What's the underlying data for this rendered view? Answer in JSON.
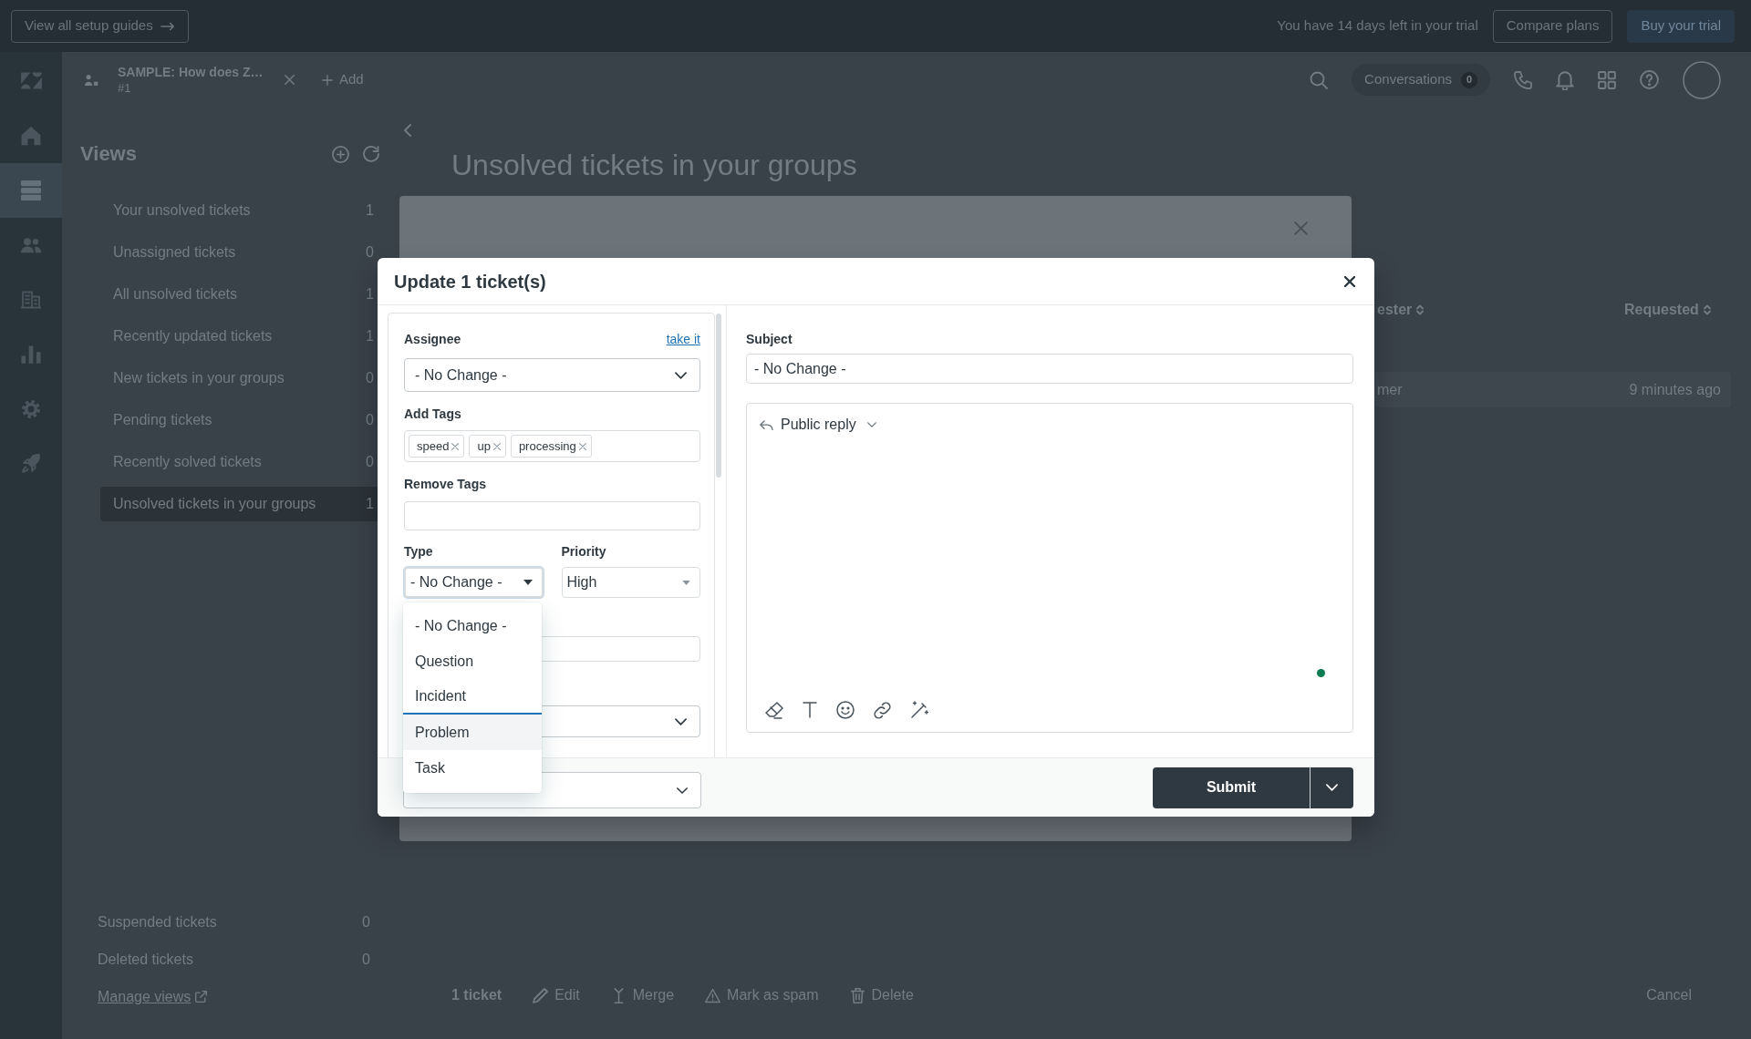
{
  "top_bar": {
    "setup_button": "View all setup guides",
    "trial_notice": "You have 14 days left in your trial",
    "buttons": [
      {
        "label": "Compare plans",
        "kind": "outline"
      },
      {
        "label": "Buy your trial",
        "kind": "filled"
      }
    ]
  },
  "nav_rail": {
    "items": [
      {
        "selected": false
      },
      {
        "selected": true
      },
      {
        "selected": false
      },
      {
        "selected": false
      },
      {
        "selected": false
      },
      {
        "selected": false
      },
      {
        "selected": false
      }
    ]
  },
  "header": {
    "tab": {
      "title": "SAMPLE: How does Z…",
      "subtitle": "#1"
    },
    "add_tab": "Add",
    "conversations": {
      "label": "Conversations",
      "count": "0"
    }
  },
  "views": {
    "title": "Views",
    "items": [
      {
        "label": "Your unsolved tickets",
        "count": "1",
        "selected": false
      },
      {
        "label": "Unassigned tickets",
        "count": "0",
        "selected": false
      },
      {
        "label": "All unsolved tickets",
        "count": "1",
        "selected": false
      },
      {
        "label": "Recently updated tickets",
        "count": "1",
        "selected": false
      },
      {
        "label": "New tickets in your groups",
        "count": "0",
        "selected": false
      },
      {
        "label": "Pending tickets",
        "count": "0",
        "selected": false
      },
      {
        "label": "Recently solved tickets",
        "count": "0",
        "selected": false
      },
      {
        "label": "Unsolved tickets in your groups",
        "count": "1",
        "selected": true
      }
    ],
    "footer_items": [
      {
        "label": "Suspended tickets",
        "count": "0"
      },
      {
        "label": "Deleted tickets",
        "count": "0"
      }
    ],
    "manage_link": "Manage views"
  },
  "main": {
    "title": "Unsolved tickets in your groups",
    "table": {
      "columns": [
        "ester",
        "Requested"
      ],
      "rows": [
        [
          "mer",
          "9 minutes ago"
        ]
      ]
    }
  },
  "bulk_bar": {
    "count": "1 ticket",
    "actions": [
      "Edit",
      "Merge",
      "Mark as spam",
      "Delete"
    ],
    "cancel": "Cancel"
  },
  "dialog": {
    "title": "Update 1 ticket(s)",
    "assignee": {
      "label": "Assignee",
      "link": "take it",
      "value": "- No Change -"
    },
    "add_tags": {
      "label": "Add Tags",
      "tags": [
        "speed",
        "up",
        "processing"
      ]
    },
    "remove_tags": {
      "label": "Remove Tags"
    },
    "type": {
      "label": "Type",
      "value": "- No Change -",
      "focused": true,
      "expanded": true,
      "options": [
        {
          "label": "- No Change -",
          "highlighted": false,
          "focused": false
        },
        {
          "label": "Question",
          "highlighted": false,
          "focused": false
        },
        {
          "label": "Incident",
          "highlighted": false,
          "focused": true
        },
        {
          "label": "Problem",
          "highlighted": true,
          "focused": false
        },
        {
          "label": "Task",
          "highlighted": false,
          "focused": false
        }
      ]
    },
    "priority": {
      "label": "Priority",
      "value": "High"
    },
    "subject": {
      "label": "Subject",
      "value": "- No Change -"
    },
    "reply_mode": "Public reply",
    "submit": "Submit"
  }
}
